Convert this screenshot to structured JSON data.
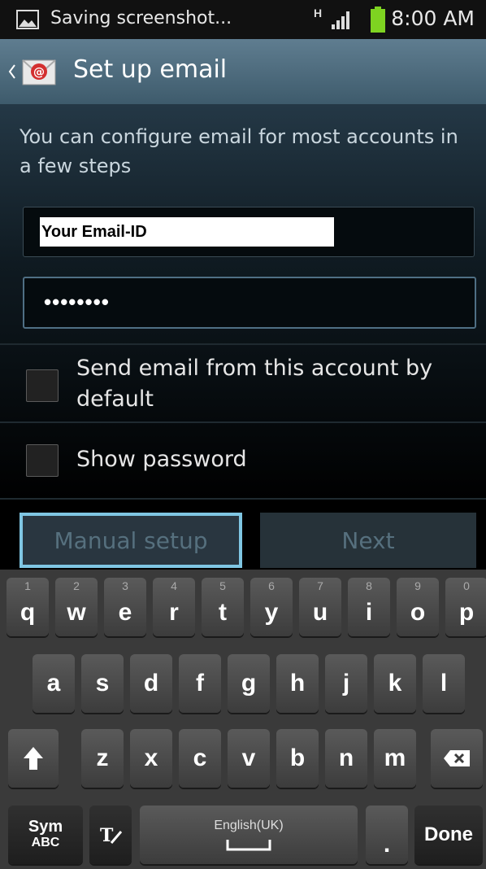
{
  "status_bar": {
    "notification_text": "Saving screenshot...",
    "network_type": "H",
    "time": "8:00 AM"
  },
  "action_bar": {
    "title": "Set up email",
    "app_icon": "email-app-icon"
  },
  "intro_text": "You can configure email for most accounts in a few steps",
  "email_field": {
    "value": "Your Email-ID"
  },
  "password_field": {
    "value": "••••••••"
  },
  "checkboxes": [
    {
      "label": "Send email from this account by default",
      "checked": false
    },
    {
      "label": "Show password",
      "checked": false
    }
  ],
  "buttons": {
    "manual_setup": "Manual setup",
    "next": "Next"
  },
  "keyboard": {
    "row1": [
      {
        "k": "q",
        "h": "1"
      },
      {
        "k": "w",
        "h": "2"
      },
      {
        "k": "e",
        "h": "3"
      },
      {
        "k": "r",
        "h": "4"
      },
      {
        "k": "t",
        "h": "5"
      },
      {
        "k": "y",
        "h": "6"
      },
      {
        "k": "u",
        "h": "7"
      },
      {
        "k": "i",
        "h": "8"
      },
      {
        "k": "o",
        "h": "9"
      },
      {
        "k": "p",
        "h": "0"
      }
    ],
    "row2": [
      "a",
      "s",
      "d",
      "f",
      "g",
      "h",
      "j",
      "k",
      "l"
    ],
    "row3": [
      "z",
      "x",
      "c",
      "v",
      "b",
      "n",
      "m"
    ],
    "sym_label_1": "Sym",
    "sym_label_2": "ABC",
    "space_label": "English(UK)",
    "period": ".",
    "done": "Done"
  },
  "colors": {
    "accent_focus": "#7fc6e3",
    "action_bar": "#4f6f80"
  }
}
